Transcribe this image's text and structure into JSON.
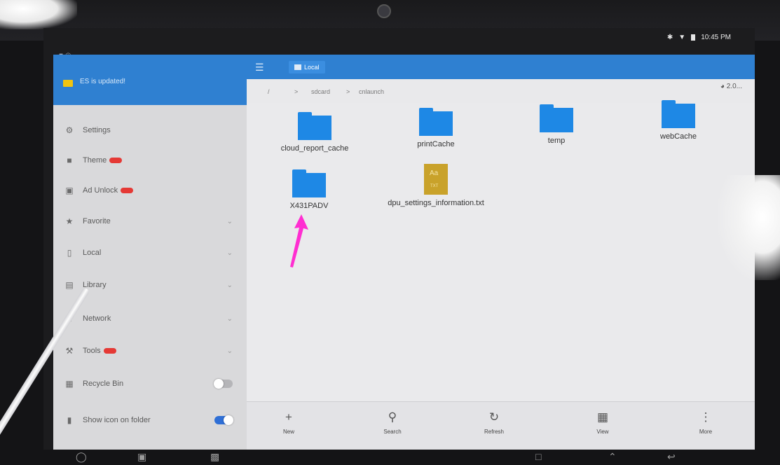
{
  "status": {
    "left_icons": "■ ◎",
    "time": "10:45 PM"
  },
  "drawer": {
    "notice": "ES is updated!",
    "items": [
      {
        "label": "Settings",
        "icon": "gear-icon"
      },
      {
        "label": "Theme",
        "icon": "shirt-icon",
        "badge": true
      },
      {
        "label": "Ad Unlock",
        "icon": "lock-icon",
        "badge": true
      },
      {
        "label": "Favorite",
        "icon": "star-icon",
        "chevron": true
      },
      {
        "label": "Local",
        "icon": "phone-icon",
        "chevron": true
      },
      {
        "label": "Library",
        "icon": "library-icon",
        "chevron": true
      },
      {
        "label": "Network",
        "icon": "network-icon",
        "chevron": true
      },
      {
        "label": "Tools",
        "icon": "wrench-icon",
        "badge": true,
        "chevron": true
      },
      {
        "label": "Recycle Bin",
        "icon": "trash-icon",
        "toggle": false
      },
      {
        "label": "Show icon on folder",
        "icon": "folder-icon",
        "toggle": true
      }
    ]
  },
  "appbar": {
    "tab_label": "Local"
  },
  "path": {
    "root": "/",
    "sep": ">",
    "crumbs": [
      "sdcard",
      "cnlaunch"
    ],
    "storage": "2.0..."
  },
  "files": [
    {
      "name": "cloud_report_cache",
      "type": "folder"
    },
    {
      "name": "printCache",
      "type": "folder"
    },
    {
      "name": "temp",
      "type": "folder"
    },
    {
      "name": "webCache",
      "type": "folder"
    },
    {
      "name": "X431PADV",
      "type": "folder"
    },
    {
      "name": "dpu_settings_information.txt",
      "type": "txt",
      "icon_text": "Aa",
      "ext": "TXT"
    }
  ],
  "bottom_bar": [
    {
      "label": "New",
      "icon": "plus-icon"
    },
    {
      "label": "Search",
      "icon": "search-icon"
    },
    {
      "label": "Refresh",
      "icon": "refresh-icon"
    },
    {
      "label": "View",
      "icon": "grid-view-icon"
    },
    {
      "label": "More",
      "icon": "more-vertical-icon"
    }
  ],
  "colors": {
    "accent": "#2f80d1",
    "folder": "#1e88e5",
    "txt_file": "#c9a22a",
    "badge": "#e53935",
    "annotation_arrow": "#ff2ed1"
  }
}
